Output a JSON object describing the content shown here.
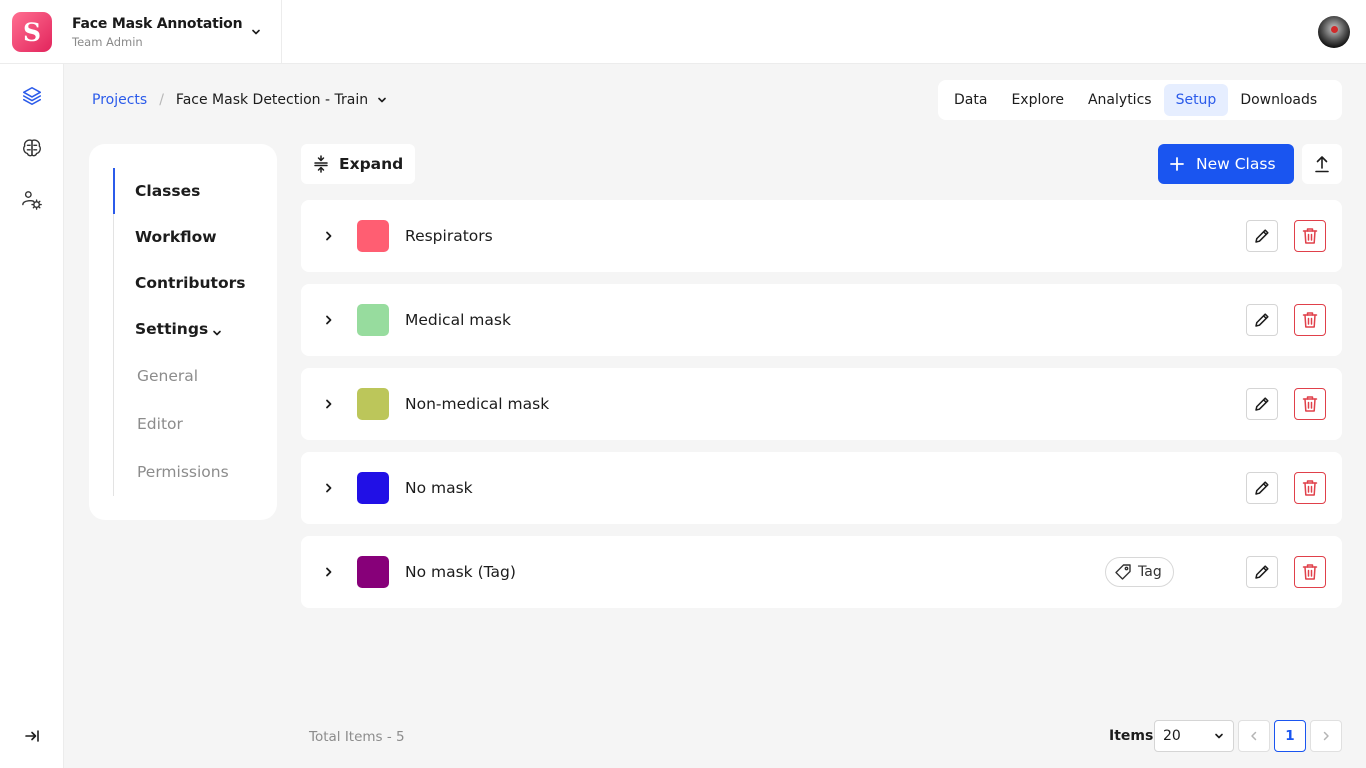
{
  "app": {
    "logo_letter": "S",
    "workspace_name": "Face Mask Annotation",
    "workspace_role": "Team Admin"
  },
  "breadcrumb": {
    "root": "Projects",
    "separator": "/",
    "current": "Face Mask Detection - Train"
  },
  "tabs": [
    {
      "label": "Data",
      "active": false
    },
    {
      "label": "Explore",
      "active": false
    },
    {
      "label": "Analytics",
      "active": false
    },
    {
      "label": "Setup",
      "active": true
    },
    {
      "label": "Downloads",
      "active": false
    }
  ],
  "settings_nav": {
    "classes": "Classes",
    "workflow": "Workflow",
    "contributors": "Contributors",
    "settings": "Settings",
    "general": "General",
    "editor": "Editor",
    "permissions": "Permissions",
    "active": "Classes"
  },
  "toolbar": {
    "expand_label": "Expand",
    "new_class_label": "New Class"
  },
  "classes": [
    {
      "name": "Respirators",
      "color": "#ff5e72",
      "tag": null
    },
    {
      "name": "Medical mask",
      "color": "#97dc9e",
      "tag": null
    },
    {
      "name": "Non-medical mask",
      "color": "#bcc65a",
      "tag": null
    },
    {
      "name": "No mask",
      "color": "#2110e6",
      "tag": null
    },
    {
      "name": "No mask (Tag)",
      "color": "#870079",
      "tag": "Tag"
    }
  ],
  "footer": {
    "total_label": "Total Items - 5",
    "items_label": "Items",
    "page_size": "20",
    "current_page": "1"
  },
  "colors": {
    "accent": "#1a55f0",
    "link": "#2b5bea",
    "danger": "#e0404a",
    "logo_gradient_start": "#ff6f91",
    "logo_gradient_end": "#e2245c"
  },
  "icons": {
    "rail": [
      "layers-icon",
      "brain-icon",
      "users-settings-icon",
      "collapse-sidebar-icon"
    ],
    "row": [
      "chevron-right-icon",
      "pencil-icon",
      "trash-icon",
      "tag-icon"
    ],
    "toolbar": [
      "expand-vertical-icon",
      "plus-icon",
      "upload-icon"
    ]
  }
}
